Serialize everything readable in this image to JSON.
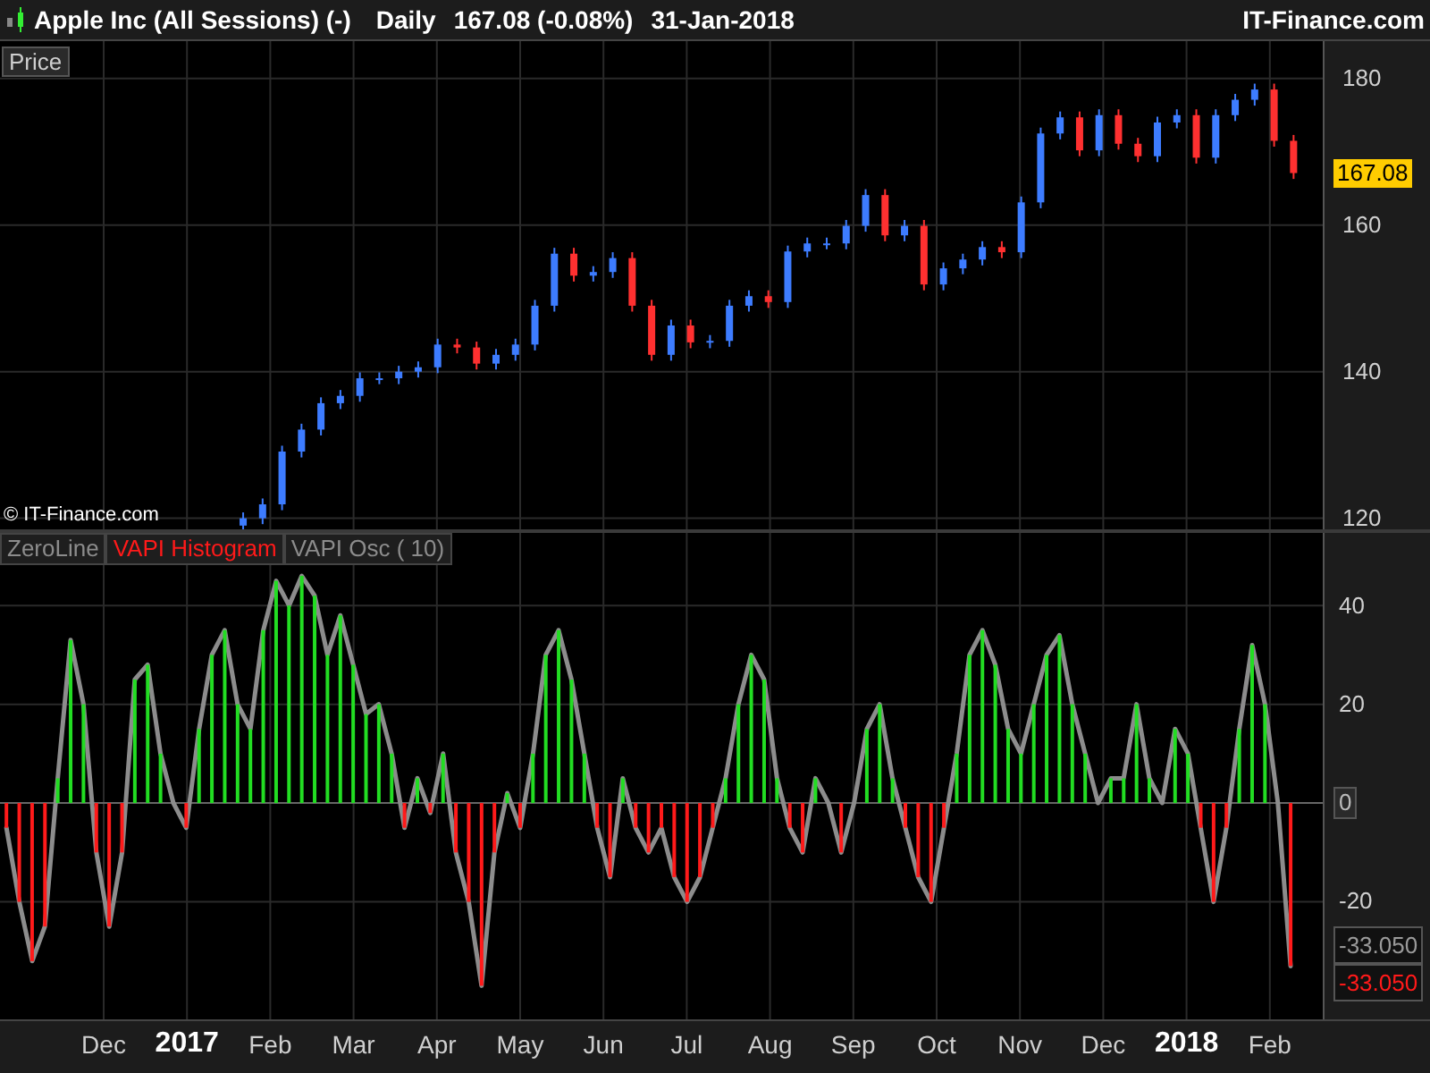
{
  "header": {
    "title": "Apple Inc (All Sessions) (-)",
    "period": "Daily",
    "quote": "167.08 (-0.08%)",
    "date": "31-Jan-2018",
    "brand": "IT-Finance.com"
  },
  "price_panel": {
    "label": "Price",
    "copyright": "© IT-Finance.com",
    "price_tag": "167.08",
    "chart_data": {
      "type": "candlestick",
      "ylim": [
        118,
        185.1
      ],
      "yticks": [
        120,
        140,
        160,
        180
      ],
      "grid": true,
      "ohlc": [
        null,
        null,
        null,
        null,
        null,
        null,
        null,
        null,
        null,
        null,
        null,
        null,
        [
          119.0,
          120.8,
          118.2,
          120.0
        ],
        [
          120.0,
          122.7,
          119.2,
          121.9
        ],
        [
          121.9,
          129.9,
          121.1,
          129.1
        ],
        [
          129.1,
          132.9,
          128.3,
          132.1
        ],
        [
          132.1,
          136.5,
          131.3,
          135.7
        ],
        [
          135.7,
          137.5,
          134.9,
          136.7
        ],
        [
          136.7,
          139.9,
          135.9,
          139.1
        ],
        [
          139.1,
          139.9,
          138.3,
          139.1
        ],
        [
          139.1,
          140.8,
          138.3,
          140.0
        ],
        [
          140.0,
          141.4,
          139.2,
          140.6
        ],
        [
          140.6,
          144.5,
          139.8,
          143.7
        ],
        [
          143.7,
          144.5,
          142.5,
          143.3
        ],
        [
          143.3,
          144.1,
          140.3,
          141.1
        ],
        [
          141.1,
          143.1,
          140.3,
          142.3
        ],
        [
          142.3,
          144.5,
          141.5,
          143.7
        ],
        [
          143.7,
          149.8,
          142.9,
          149.0
        ],
        [
          149.0,
          156.9,
          148.2,
          156.1
        ],
        [
          156.1,
          156.9,
          152.3,
          153.1
        ],
        [
          153.1,
          154.4,
          152.3,
          153.6
        ],
        [
          153.6,
          156.3,
          152.8,
          155.5
        ],
        [
          155.5,
          156.3,
          148.2,
          149.0
        ],
        [
          149.0,
          149.8,
          141.5,
          142.3
        ],
        [
          142.3,
          147.1,
          141.5,
          146.3
        ],
        [
          146.3,
          147.1,
          143.2,
          144.0
        ],
        [
          144.0,
          145.0,
          143.2,
          144.2
        ],
        [
          144.2,
          149.8,
          143.4,
          149.0
        ],
        [
          149.0,
          151.1,
          148.2,
          150.3
        ],
        [
          150.3,
          151.1,
          148.7,
          149.5
        ],
        [
          149.5,
          157.2,
          148.7,
          156.4
        ],
        [
          156.4,
          158.3,
          155.6,
          157.5
        ],
        [
          157.5,
          158.3,
          156.7,
          157.5
        ],
        [
          157.5,
          160.7,
          156.7,
          159.9
        ],
        [
          159.9,
          164.9,
          159.1,
          164.1
        ],
        [
          164.1,
          164.9,
          157.8,
          158.6
        ],
        [
          158.6,
          160.7,
          157.8,
          159.9
        ],
        [
          159.9,
          160.7,
          151.1,
          151.9
        ],
        [
          151.9,
          154.9,
          151.1,
          154.1
        ],
        [
          154.1,
          156.1,
          153.3,
          155.3
        ],
        [
          155.3,
          157.8,
          154.5,
          157.0
        ],
        [
          157.0,
          157.8,
          155.5,
          156.3
        ],
        [
          156.3,
          163.9,
          155.5,
          163.1
        ],
        [
          163.1,
          173.3,
          162.3,
          172.5
        ],
        [
          172.5,
          175.5,
          171.7,
          174.7
        ],
        [
          174.7,
          175.5,
          169.4,
          170.2
        ],
        [
          170.2,
          175.8,
          169.4,
          175.0
        ],
        [
          175.0,
          175.8,
          170.3,
          171.1
        ],
        [
          171.1,
          171.9,
          168.6,
          169.4
        ],
        [
          169.4,
          174.8,
          168.6,
          174.0
        ],
        [
          174.0,
          175.8,
          173.2,
          175.0
        ],
        [
          175.0,
          175.8,
          168.4,
          169.2
        ],
        [
          169.2,
          175.8,
          168.4,
          175.0
        ],
        [
          175.0,
          177.9,
          174.2,
          177.1
        ],
        [
          177.1,
          179.3,
          176.3,
          178.5
        ],
        [
          178.5,
          179.3,
          170.7,
          171.5
        ],
        [
          171.5,
          172.3,
          166.3,
          167.1
        ],
        null
      ]
    }
  },
  "oscillator_panel": {
    "legend": [
      {
        "label": "ZeroLine",
        "color": "#8c8c8c"
      },
      {
        "color": "#ff1a1a"
      },
      {
        "color": "#8c8c8c"
      }
    ],
    "value_tags": [
      {
        "label": "-33.050",
        "color": "#9a9a9a"
      },
      {
        "label": "-33.050",
        "color": "#ff1a1a"
      }
    ],
    "chart_data": {
      "type": "bar",
      "ylim": [
        -43.8,
        54.7
      ],
      "yticks": [
        40,
        20,
        0,
        -20
      ],
      "grid": true,
      "series": [
        {
          "name": "VAPI Histogram",
          "colors": [
            "#ff1a1a",
            "#ff1a1a",
            "#ff1a1a",
            "#ff1a1a",
            "#22dd22",
            "#22dd22",
            "#22dd22",
            "#ff1a1a",
            "#ff1a1a",
            "#ff1a1a",
            "#22dd22",
            "#22dd22",
            "#22dd22",
            null,
            "#ff1a1a",
            "#22dd22",
            "#22dd22",
            "#22dd22",
            "#22dd22",
            "#22dd22",
            "#22dd22",
            "#22dd22",
            "#22dd22",
            "#22dd22",
            "#22dd22",
            "#22dd22",
            "#22dd22",
            "#22dd22",
            "#22dd22",
            "#22dd22",
            "#22dd22",
            "#ff1a1a",
            "#22dd22",
            "#ff1a1a",
            "#22dd22",
            "#ff1a1a",
            "#ff1a1a",
            "#ff1a1a",
            "#ff1a1a",
            "#22dd22",
            "#ff1a1a",
            "#22dd22",
            "#22dd22",
            "#22dd22",
            "#22dd22",
            "#22dd22",
            "#ff1a1a",
            "#ff1a1a",
            "#22dd22",
            "#ff1a1a",
            "#ff1a1a",
            "#ff1a1a",
            "#ff1a1a",
            "#ff1a1a",
            "#ff1a1a",
            "#ff1a1a",
            "#22dd22",
            "#22dd22",
            "#22dd22",
            "#22dd22",
            "#22dd22",
            "#ff1a1a",
            "#ff1a1a",
            "#22dd22",
            null,
            "#ff1a1a",
            null,
            "#22dd22",
            "#22dd22",
            "#22dd22",
            "#ff1a1a",
            "#ff1a1a",
            "#ff1a1a",
            "#ff1a1a",
            "#22dd22",
            "#22dd22",
            "#22dd22",
            "#22dd22",
            "#22dd22",
            "#22dd22",
            "#22dd22",
            "#22dd22",
            "#22dd22",
            "#22dd22",
            "#22dd22",
            null,
            "#22dd22",
            "#22dd22",
            "#22dd22",
            "#22dd22",
            null,
            "#22dd22",
            "#22dd22",
            "#ff1a1a",
            "#ff1a1a",
            "#ff1a1a",
            "#22dd22",
            "#22dd22",
            "#22dd22",
            null,
            "#ff1a1a",
            null,
            null
          ],
          "values": [
            -5,
            -20,
            -32,
            -25,
            5,
            33,
            20,
            -10,
            -25,
            -10,
            25,
            28,
            10,
            0,
            -5,
            15,
            30,
            35,
            20,
            15,
            35,
            45,
            40,
            46,
            42,
            30,
            38,
            28,
            18,
            20,
            10,
            -5,
            5,
            -2,
            10,
            -10,
            -20,
            -37,
            -10,
            2,
            -5,
            10,
            30,
            35,
            25,
            10,
            -5,
            -15,
            5,
            -5,
            -10,
            -5,
            -15,
            -20,
            -15,
            -5,
            5,
            20,
            30,
            25,
            5,
            -5,
            -10,
            5,
            0,
            -10,
            0,
            15,
            20,
            5,
            -5,
            -15,
            -20,
            -5,
            10,
            30,
            35,
            28,
            15,
            10,
            20,
            30,
            34,
            20,
            10,
            0,
            5,
            5,
            20,
            5,
            0,
            15,
            10,
            -5,
            -20,
            -5,
            15,
            32,
            20,
            0,
            -33,
            null,
            null
          ]
        },
        {
          "name": "VAPI Osc ( 10)",
          "type": "line",
          "values": [
            -5,
            -20,
            -32,
            -25,
            5,
            33,
            20,
            -10,
            -25,
            -10,
            25,
            28,
            10,
            0,
            -5,
            15,
            30,
            35,
            20,
            15,
            35,
            45,
            40,
            46,
            42,
            30,
            38,
            28,
            18,
            20,
            10,
            -5,
            5,
            -2,
            10,
            -10,
            -20,
            -37,
            -10,
            2,
            -5,
            10,
            30,
            35,
            25,
            10,
            -5,
            -15,
            5,
            -5,
            -10,
            -5,
            -15,
            -20,
            -15,
            -5,
            5,
            20,
            30,
            25,
            5,
            -5,
            -10,
            5,
            0,
            -10,
            0,
            15,
            20,
            5,
            -5,
            -15,
            -20,
            -5,
            10,
            30,
            35,
            28,
            15,
            10,
            20,
            30,
            34,
            20,
            10,
            0,
            5,
            5,
            20,
            5,
            0,
            15,
            10,
            -5,
            -20,
            -5,
            15,
            32,
            20,
            0,
            -33,
            null,
            null
          ]
        }
      ]
    }
  },
  "time_axis": [
    {
      "label": "Dec",
      "kind": "month"
    },
    {
      "label": "2017",
      "kind": "year"
    },
    {
      "label": "Feb",
      "kind": "month"
    },
    {
      "label": "Mar",
      "kind": "month"
    },
    {
      "label": "Apr",
      "kind": "month"
    },
    {
      "label": "May",
      "kind": "month"
    },
    {
      "label": "Jun",
      "kind": "month"
    },
    {
      "label": "Jul",
      "kind": "month"
    },
    {
      "label": "Aug",
      "kind": "month"
    },
    {
      "label": "Sep",
      "kind": "month"
    },
    {
      "label": "Oct",
      "kind": "month"
    },
    {
      "label": "Nov",
      "kind": "month"
    },
    {
      "label": "Dec",
      "kind": "month"
    },
    {
      "label": "2018",
      "kind": "year"
    },
    {
      "label": "Feb",
      "kind": "month"
    }
  ]
}
